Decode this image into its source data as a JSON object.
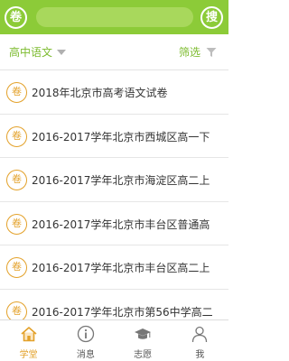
{
  "header": {
    "left_button_label": "卷",
    "right_button_label": "搜"
  },
  "filter": {
    "subject_label": "高中语文",
    "filter_label": "筛选"
  },
  "list": {
    "icon_label": "卷",
    "items": [
      {
        "title": "2018年北京市高考语文试卷"
      },
      {
        "title": "2016-2017学年北京市西城区高一下"
      },
      {
        "title": "2016-2017学年北京市海淀区高二上"
      },
      {
        "title": "2016-2017学年北京市丰台区普通高"
      },
      {
        "title": "2016-2017学年北京市丰台区高二上"
      },
      {
        "title": "2016-2017学年北京市第56中学高二"
      }
    ]
  },
  "bottom_nav": {
    "items": [
      {
        "label": "学堂",
        "icon": "home-icon",
        "active": true
      },
      {
        "label": "消息",
        "icon": "info-icon",
        "active": false
      },
      {
        "label": "志愿",
        "icon": "graduation-cap-icon",
        "active": false
      },
      {
        "label": "我",
        "icon": "user-icon",
        "active": false
      }
    ]
  },
  "colors": {
    "brand_green": "#8ccb38",
    "accent_orange": "#e3a12a",
    "filter_text_green": "#7cbb2e"
  }
}
